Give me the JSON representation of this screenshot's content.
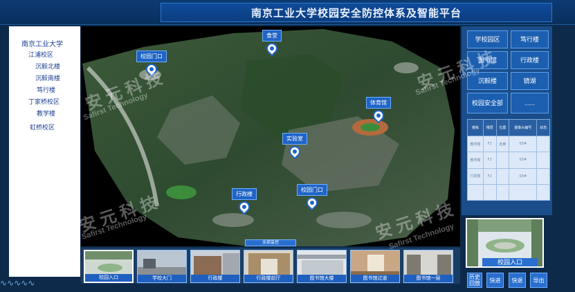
{
  "header": {
    "title": "南京工业大学校园安全防控体系及智能平台"
  },
  "sidebar": {
    "items": [
      {
        "label": "南京工业大学"
      },
      {
        "label": "江浦校区"
      },
      {
        "label": "沉毅北楼"
      },
      {
        "label": "沉毅南楼"
      },
      {
        "label": "笃行楼"
      },
      {
        "label": "丁家桥校区"
      },
      {
        "label": "教学楼"
      },
      {
        "label": "虹桥校区"
      }
    ]
  },
  "map": {
    "markers": [
      {
        "label": "校园门口"
      },
      {
        "label": "食堂"
      },
      {
        "label": "体育馆"
      },
      {
        "label": "实验室"
      },
      {
        "label": "行政楼"
      },
      {
        "label": "校园门口"
      }
    ],
    "bottom_button": "全部监控"
  },
  "right_panel": {
    "buttons": [
      {
        "label": "学校园区"
      },
      {
        "label": "笃行楼"
      },
      {
        "label": "图书馆"
      },
      {
        "label": "行政楼"
      },
      {
        "label": "沉毅楼"
      },
      {
        "label": "镜湖"
      },
      {
        "label": "校园安全部"
      },
      {
        "label": "......"
      }
    ],
    "table": {
      "headers": [
        "楼栋",
        "楼层",
        "位置",
        "摄像头编号",
        "状态"
      ],
      "rows": [
        [
          "教学楼",
          "F1",
          "走廊",
          "03#",
          ""
        ],
        [
          "教学楼",
          "F1",
          "",
          "03#",
          ""
        ],
        [
          "行政楼",
          "F2",
          "",
          "03#",
          ""
        ],
        [
          "",
          "",
          "",
          "",
          ""
        ]
      ]
    }
  },
  "preview": {
    "label": "校园入口"
  },
  "thumbnails": [
    {
      "label": "校园入口"
    },
    {
      "label": "学校大门"
    },
    {
      "label": "行政楼"
    },
    {
      "label": "行政楼前厅"
    },
    {
      "label": "图书馆大楼"
    },
    {
      "label": "图书馆过道"
    },
    {
      "label": "图书馆一层"
    }
  ],
  "controls": [
    {
      "label": "历史回放"
    },
    {
      "label": "快进"
    },
    {
      "label": "快退"
    },
    {
      "label": "导出"
    }
  ],
  "watermarks": {
    "cn": "安 元 科 技",
    "en": "Safirst Technology"
  },
  "colors": {
    "brand_blue": "#1f64c6",
    "header_bg": "#0d3a73",
    "link_blue": "#1f3f95"
  }
}
